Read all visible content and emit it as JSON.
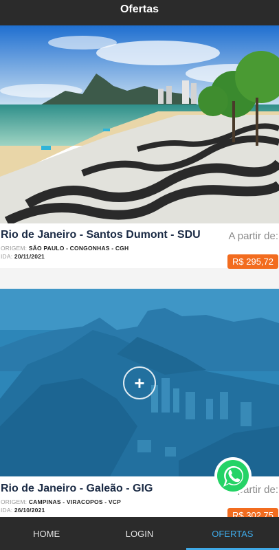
{
  "header": {
    "title": "Ofertas"
  },
  "offers": [
    {
      "route": "Rio de Janeiro - Santos Dumont - SDU",
      "origin_label": "ORIGEM:",
      "origin_value": "SÃO PAULO - CONGONHAS - CGH",
      "date_label": "IDA:",
      "date_value": "20/11/2021",
      "from_label": "A partir de:",
      "price": "R$ 295,72"
    },
    {
      "route": "Rio de Janeiro - Galeão - GIG",
      "origin_label": "ORIGEM:",
      "origin_value": "CAMPINAS - VIRACOPOS - VCP",
      "date_label": "IDA:",
      "date_value": "26/10/2021",
      "from_label": "A partir de:",
      "price": "R$ 302,75"
    }
  ],
  "nav": {
    "items": [
      {
        "label": "HOME"
      },
      {
        "label": "LOGIN"
      },
      {
        "label": "OFERTAS"
      }
    ],
    "active": "OFERTAS"
  },
  "colors": {
    "bar": "#2b2b2b",
    "accent": "#3fa9e6",
    "price_bg": "#f26c1f",
    "route_text": "#1a2a44"
  },
  "icons": [
    "plus-circle-icon",
    "whatsapp-icon"
  ]
}
